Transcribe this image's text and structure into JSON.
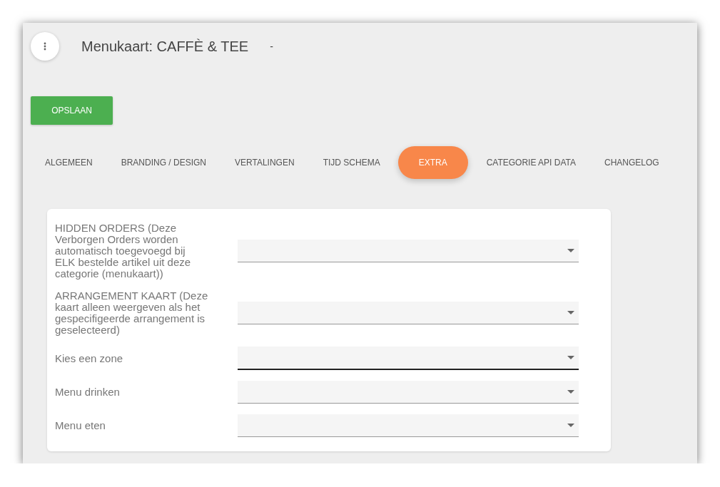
{
  "header": {
    "title": "Menukaart: CAFFÈ & TEE",
    "subtitle": "-"
  },
  "save_button": "OPSLAAN",
  "tabs": [
    {
      "label": "ALGEMEEN",
      "selected": false
    },
    {
      "label": "BRANDING / DESIGN",
      "selected": false
    },
    {
      "label": "VERTALINGEN",
      "selected": false
    },
    {
      "label": "TIJD SCHEMA",
      "selected": false
    },
    {
      "label": "EXTRA",
      "selected": true
    },
    {
      "label": "CATEGORIE API DATA",
      "selected": false
    },
    {
      "label": "CHANGELOG",
      "selected": false
    }
  ],
  "fields": [
    {
      "label": "HIDDEN ORDERS (Deze Verborgen Orders worden automatisch toegevoegd bij ELK bestelde artikel uit deze categorie (menukaart))",
      "focused": false
    },
    {
      "label": "ARRANGEMENT KAART (Deze kaart alleen weergeven als het gespecifigeerde arrangement is geselecteerd)",
      "focused": false
    },
    {
      "label": "Kies een zone",
      "focused": true
    },
    {
      "label": "Menu drinken",
      "focused": false
    },
    {
      "label": "Menu eten",
      "focused": false
    }
  ]
}
